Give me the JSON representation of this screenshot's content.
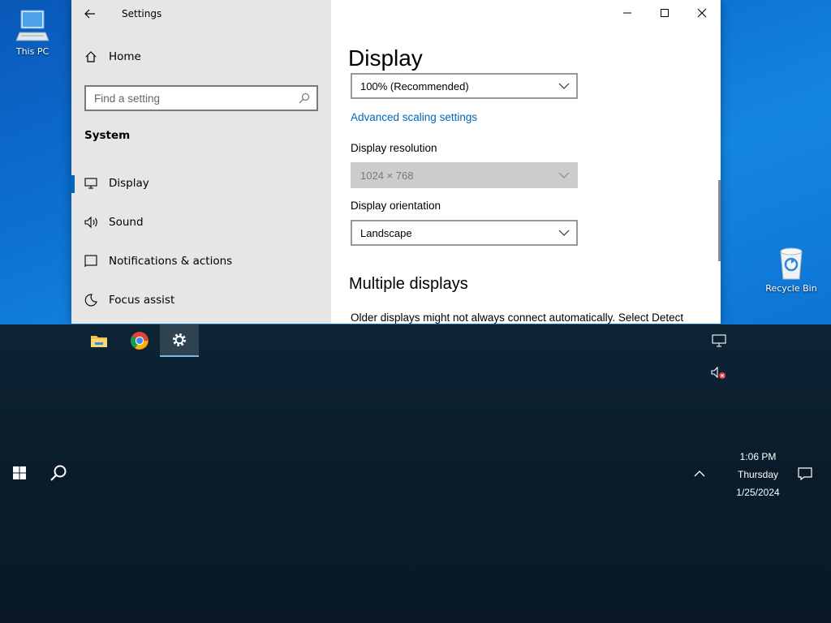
{
  "desktop": {
    "icons": [
      {
        "label": "This PC",
        "icon": "computer-icon"
      },
      {
        "label": "Recycle Bin",
        "icon": "recycle-bin-icon"
      }
    ]
  },
  "window": {
    "title": "Settings",
    "caption": {
      "minimize": "minimize-icon",
      "maximize": "maximize-icon",
      "close": "close-icon"
    }
  },
  "sidebar": {
    "home_label": "Home",
    "search_placeholder": "Find a setting",
    "section": "System",
    "items": [
      {
        "label": "Display",
        "icon": "monitor-icon",
        "active": true
      },
      {
        "label": "Sound",
        "icon": "speaker-icon"
      },
      {
        "label": "Notifications & actions",
        "icon": "notification-icon"
      },
      {
        "label": "Focus assist",
        "icon": "moon-icon"
      }
    ]
  },
  "main": {
    "heading": "Display",
    "scale_value": "100% (Recommended)",
    "advanced_link": "Advanced scaling settings",
    "resolution_label": "Display resolution",
    "resolution_value": "1024 × 768",
    "orientation_label": "Display orientation",
    "orientation_value": "Landscape",
    "multiple_heading": "Multiple displays",
    "multiple_text": "Older displays might not always connect automatically. Select Detect"
  },
  "taskbar": {
    "pinned": [
      {
        "name": "File Explorer",
        "icon": "folder-icon"
      },
      {
        "name": "Google Chrome",
        "icon": "chrome-icon"
      },
      {
        "name": "Settings",
        "icon": "gear-icon",
        "active": true
      }
    ],
    "clock": {
      "time": "1:06 PM",
      "day": "Thursday",
      "date": "1/25/2024"
    }
  },
  "colors": {
    "accent": "#0067c0",
    "link": "#0067b8",
    "desktop": "#0c6fd1",
    "taskbar": "#0b1f2e"
  }
}
